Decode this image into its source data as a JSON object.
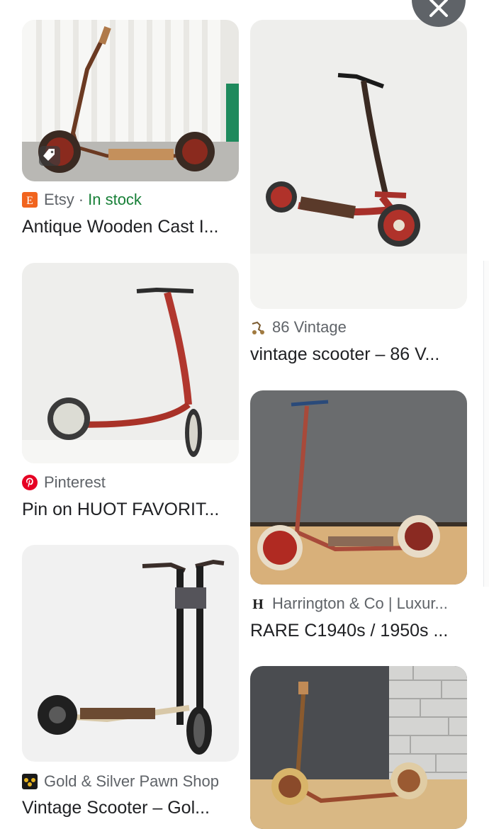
{
  "results": {
    "left": [
      {
        "source": "Etsy",
        "stock_separator": "·",
        "stock": "In stock",
        "title": "Antique Wooden Cast I...",
        "favicon": "etsy-favicon",
        "favicon_letter": "E"
      },
      {
        "source": "Pinterest",
        "title": "Pin on HUOT FAVORIT...",
        "favicon": "pinterest-favicon"
      },
      {
        "source": "Gold & Silver Pawn Shop",
        "title": "Vintage Scooter – Gol...",
        "favicon": "pawn-shop-favicon"
      }
    ],
    "right": [
      {
        "source": "86 Vintage",
        "title": "vintage scooter – 86 V...",
        "favicon": "86-vintage-favicon"
      },
      {
        "source": "Harrington & Co | Luxur...",
        "title": "RARE C1940s / 1950s ...",
        "favicon": "harrington-favicon",
        "favicon_letter": "H"
      },
      {
        "thumbnail_only": true
      }
    ]
  },
  "colors": {
    "etsy": "#f1641e",
    "pinterest": "#e60023",
    "in_stock": "#188038",
    "close_button": "#5f6368"
  },
  "close_icon": "close-icon"
}
